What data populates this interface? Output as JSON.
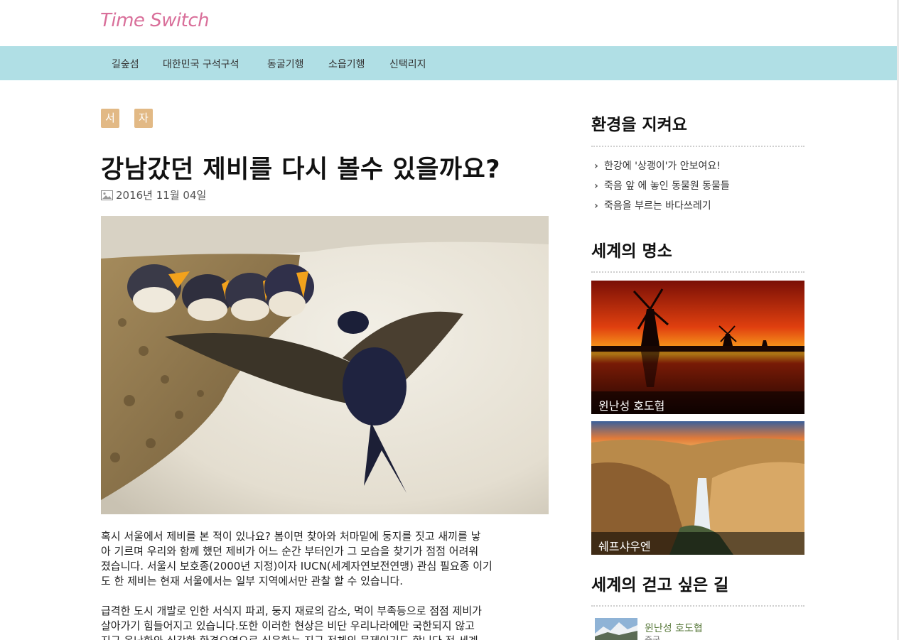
{
  "site": {
    "logo": "Time Switch"
  },
  "nav": [
    "길숲섬",
    "대한민국 구석구석",
    "동굴기행",
    "소읍기행",
    "신택리지"
  ],
  "article": {
    "tags": [
      "서울",
      "자연"
    ],
    "title": "강남갔던 제비를 다시 볼수 있을까요?",
    "date": "2016년 11월 04일",
    "paragraphs": [
      [
        "혹시 서울에서 제비를 본 적이 있나요? 봄이면 찾아와 처마밑에 둥지를 짓고 새끼를 낳",
        "아 기르며 우리와 함께 했던 제비가 어느 순간 부터인가 그 모습을 찾기가 점점 어려워",
        "졌습니다. 서울시 보호종(2000년 지정)이자 IUCN(세계자연보전연맹) 관심 필요종 이기",
        "도 한 제비는 현재 서울에서는 일부 지역에서만 관찰 할 수 있습니다."
      ],
      [
        "급격한 도시 개발로 인한 서식지 파괴, 둥지 재료의 감소, 먹이 부족등으로 점점 제비가",
        "살아가기 힘들어지고 있습니다.또한 이러한 현상은 비단 우리나라에만 국한되지 않고",
        "지구 온난화와 심각한 환경오염으로 심은화는 지구 전체의 문제이기도 합니다 전 세계"
      ]
    ]
  },
  "sidebar": {
    "env": {
      "title": "환경을 지켜요",
      "links": [
        "한강에 '상괭이'가 안보여요!",
        "죽음 앞 에 놓인 동물원 동물들",
        "죽음을 부르는 바다쓰레기"
      ]
    },
    "world": {
      "title": "세계의 명소",
      "cards": [
        "윈난성 호도협",
        "쉐프샤우엔"
      ]
    },
    "walk": {
      "title": "세계의 걷고 싶은 길",
      "items": [
        {
          "name": "윈난성 호도협",
          "sub": "중국"
        }
      ]
    }
  }
}
